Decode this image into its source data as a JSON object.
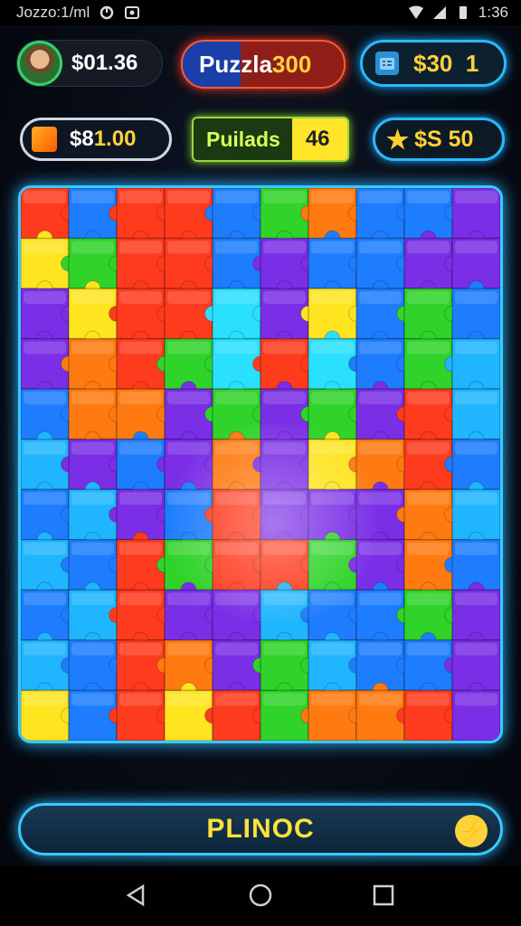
{
  "status_bar": {
    "left_text": "Jozzo:1/ml",
    "time": "1:36"
  },
  "hud": {
    "balance": "$01.36",
    "title_label": "Puzzla",
    "title_value": "300",
    "wallet_value": "$30",
    "wallet_count": "1",
    "coins_prefix": "$8",
    "coins_value": "1.00",
    "pieces_label": "Puilads",
    "pieces_value": "46",
    "stars_value": "$S 50"
  },
  "board": {
    "cols": 10,
    "rows": 11,
    "colors": {
      "red": "#ff3b1e",
      "orange": "#ff7a10",
      "yellow": "#ffe420",
      "green": "#2fd32a",
      "blue": "#1e7dff",
      "lightblue": "#1fb5ff",
      "cyan": "#2ae0ff",
      "purple": "#7a2ee6",
      "violet": "#5a2bd1"
    },
    "grid": [
      [
        "red",
        "blue",
        "red",
        "red",
        "blue",
        "green",
        "orange",
        "blue",
        "blue",
        "purple"
      ],
      [
        "yellow",
        "green",
        "red",
        "red",
        "blue",
        "purple",
        "blue",
        "blue",
        "purple",
        "purple"
      ],
      [
        "purple",
        "yellow",
        "red",
        "red",
        "cyan",
        "purple",
        "yellow",
        "blue",
        "green",
        "blue"
      ],
      [
        "purple",
        "orange",
        "red",
        "green",
        "cyan",
        "red",
        "cyan",
        "blue",
        "green",
        "lightblue"
      ],
      [
        "blue",
        "orange",
        "orange",
        "purple",
        "green",
        "purple",
        "green",
        "purple",
        "red",
        "lightblue"
      ],
      [
        "lightblue",
        "purple",
        "blue",
        "purple",
        "orange",
        "purple",
        "yellow",
        "orange",
        "red",
        "blue"
      ],
      [
        "blue",
        "lightblue",
        "purple",
        "blue",
        "red",
        "purple",
        "purple",
        "purple",
        "orange",
        "lightblue"
      ],
      [
        "lightblue",
        "blue",
        "red",
        "green",
        "red",
        "red",
        "green",
        "purple",
        "orange",
        "blue"
      ],
      [
        "blue",
        "lightblue",
        "red",
        "purple",
        "purple",
        "lightblue",
        "blue",
        "blue",
        "green",
        "purple"
      ],
      [
        "lightblue",
        "blue",
        "red",
        "orange",
        "purple",
        "green",
        "lightblue",
        "blue",
        "blue",
        "purple"
      ],
      [
        "yellow",
        "blue",
        "red",
        "yellow",
        "red",
        "green",
        "orange",
        "orange",
        "red",
        "purple"
      ]
    ]
  },
  "play_button": {
    "label": "PLINOC"
  }
}
